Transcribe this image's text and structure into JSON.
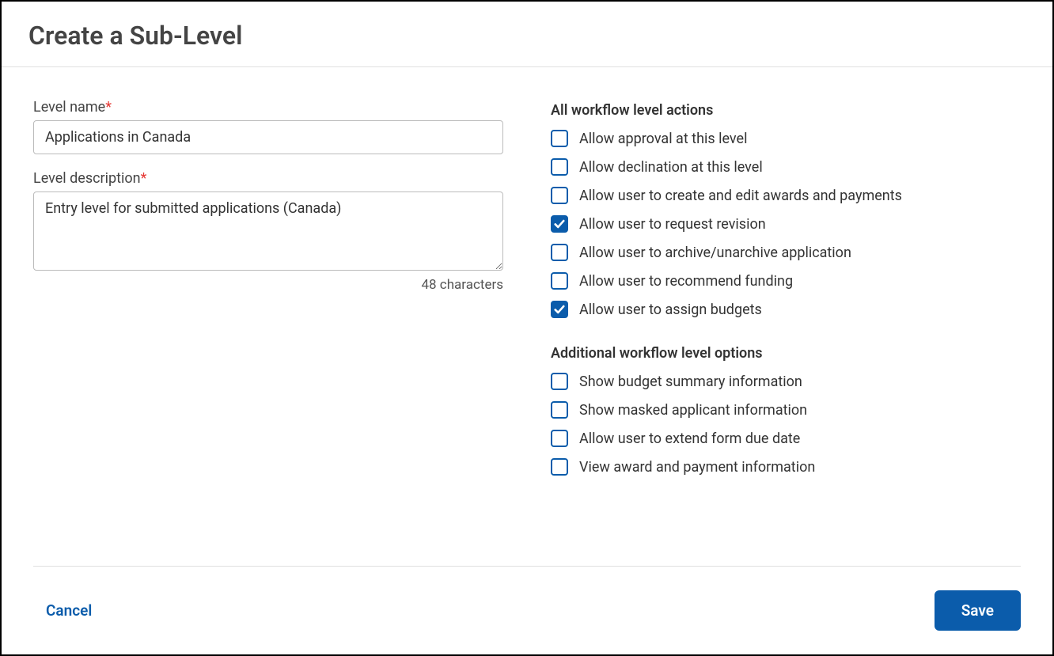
{
  "dialog": {
    "title": "Create a Sub-Level"
  },
  "left": {
    "levelName": {
      "label": "Level name",
      "value": "Applications in Canada"
    },
    "levelDescription": {
      "label": "Level description",
      "value": "Entry level for submitted applications (Canada)",
      "charCount": "48 characters"
    }
  },
  "right": {
    "actionsHeading": "All workflow level actions",
    "actions": [
      {
        "label": "Allow approval at this level",
        "checked": false
      },
      {
        "label": "Allow declination at this level",
        "checked": false
      },
      {
        "label": "Allow user to create and edit awards and payments",
        "checked": false
      },
      {
        "label": "Allow user to request revision",
        "checked": true
      },
      {
        "label": "Allow user to archive/unarchive application",
        "checked": false
      },
      {
        "label": "Allow user to recommend funding",
        "checked": false
      },
      {
        "label": "Allow user to assign budgets",
        "checked": true
      }
    ],
    "optionsHeading": "Additional workflow level options",
    "options": [
      {
        "label": "Show budget summary information",
        "checked": false
      },
      {
        "label": "Show masked applicant information",
        "checked": false
      },
      {
        "label": "Allow user to extend form due date",
        "checked": false
      },
      {
        "label": "View award and payment information",
        "checked": false
      }
    ]
  },
  "footer": {
    "cancel": "Cancel",
    "save": "Save"
  }
}
